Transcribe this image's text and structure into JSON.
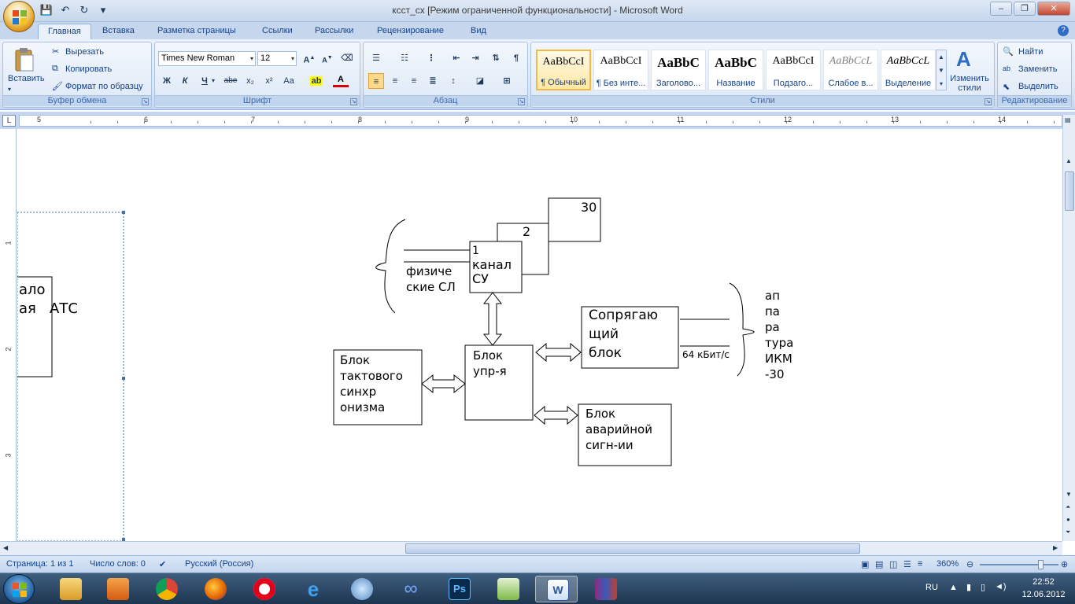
{
  "window": {
    "title": "ксст_сх [Режим ограниченной функциональности] - Microsoft Word",
    "minimize": "–",
    "maximize": "❐",
    "close": "✕"
  },
  "tabs": [
    "Главная",
    "Вставка",
    "Разметка страницы",
    "Ссылки",
    "Рассылки",
    "Рецензирование",
    "Вид"
  ],
  "ribbon": {
    "clipboard": {
      "label": "Буфер обмена",
      "paste": "Вставить",
      "cut": "Вырезать",
      "copy": "Копировать",
      "format_painter": "Формат по образцу"
    },
    "font": {
      "label": "Шрифт",
      "font_name": "Times New Roman",
      "font_size": "12",
      "bold": "Ж",
      "italic": "К",
      "underline": "Ч",
      "strike": "abe",
      "subscript": "x₂",
      "superscript": "x²",
      "case": "Aa"
    },
    "paragraph": {
      "label": "Абзац"
    },
    "styles": {
      "label": "Стили",
      "items": [
        {
          "sample": "AaBbCcI",
          "name": "¶ Обычный"
        },
        {
          "sample": "AaBbCcI",
          "name": "¶ Без инте..."
        },
        {
          "sample": "AaBbC",
          "name": "Заголово..."
        },
        {
          "sample": "AaBbC",
          "name": "Название"
        },
        {
          "sample": "AaBbCcI",
          "name": "Подзаго..."
        },
        {
          "sample": "AaBbCcL",
          "name": "Слабое в..."
        },
        {
          "sample": "AaBbCcL",
          "name": "Выделение"
        }
      ],
      "change_styles": "Изменить стили"
    },
    "editing": {
      "label": "Редактирование",
      "find": "Найти",
      "replace": "Заменить",
      "select": "Выделить"
    }
  },
  "ruler": {
    "numbers": [
      "5",
      "6",
      "7",
      "8",
      "9",
      "10",
      "11",
      "12",
      "13",
      "14"
    ]
  },
  "vruler": {
    "numbers": [
      "1",
      "2",
      "3"
    ]
  },
  "document": {
    "left_box_lines": [
      "ало",
      "ая   АТС"
    ],
    "ch1_num": "1",
    "ch1_text": "канал\nСУ",
    "ch2_num": "2",
    "ch30_num": "30",
    "phys_lines": "физиче\nские СЛ",
    "block_ctrl": "Блок\nупр-я",
    "block_sync": "Блок\nтактового\nсинхр\nонизма",
    "block_interface": "Сопрягаю\nщий\nблок",
    "block_alarm": "Блок\nаварийной\nсигн-ии",
    "speed": "64 кБит/с",
    "apparatus": "ап\nпа\nра\nтура\nИКМ\n-30"
  },
  "status": {
    "page": "Страница: 1 из 1",
    "words": "Число слов: 0",
    "language": "Русский (Россия)",
    "zoom": "360%"
  },
  "taskbar": {
    "lang": "RU",
    "time": "22:52",
    "date": "12.06.2012"
  },
  "colors": {
    "ribbon_text": "#15428b",
    "accent": "#f3b942"
  }
}
